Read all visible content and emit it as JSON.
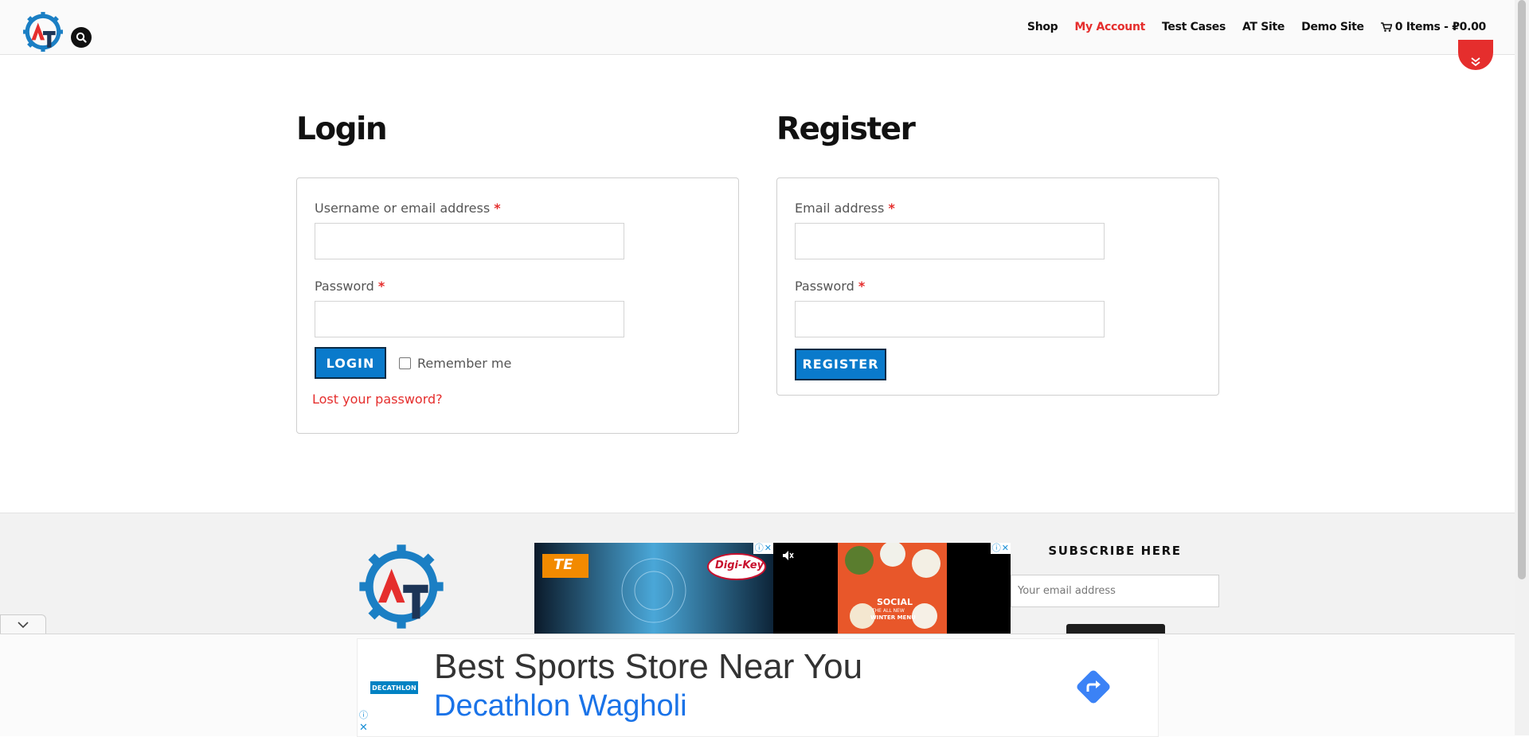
{
  "header": {
    "nav": [
      {
        "label": "Shop",
        "active": false
      },
      {
        "label": "My Account",
        "active": true
      },
      {
        "label": "Test Cases",
        "active": false
      },
      {
        "label": "AT Site",
        "active": false
      },
      {
        "label": "Demo Site",
        "active": false
      }
    ],
    "cart_label": "0 Items - ₽0.00",
    "accent_color": "#e52e2d"
  },
  "login": {
    "title": "Login",
    "username_label": "Username or email address",
    "username_value": "",
    "password_label": "Password",
    "password_value": "",
    "required_mark": "*",
    "button_label": "LOGIN",
    "remember_label": "Remember me",
    "remember_checked": false,
    "lost_password": "Lost your password?"
  },
  "register": {
    "title": "Register",
    "email_label": "Email address",
    "email_value": "",
    "password_label": "Password",
    "password_value": "",
    "required_mark": "*",
    "button_label": "REGISTER"
  },
  "footer": {
    "subscribe_title": "SUBSCRIBE HERE",
    "subscribe_placeholder": "Your email address"
  },
  "ads": {
    "banner_1_brand": "TE",
    "banner_1_partner": "Digi-Key",
    "banner_2_text": "SOCIAL",
    "banner_2_line2": "THE ALL NEW",
    "banner_2_line3": "WINTER MENU",
    "anchor_logo": "DECATHLON",
    "anchor_headline": "Best Sports Store Near You",
    "anchor_subline": "Decathlon Wagholi",
    "brand_blue": "#0a7acb"
  }
}
